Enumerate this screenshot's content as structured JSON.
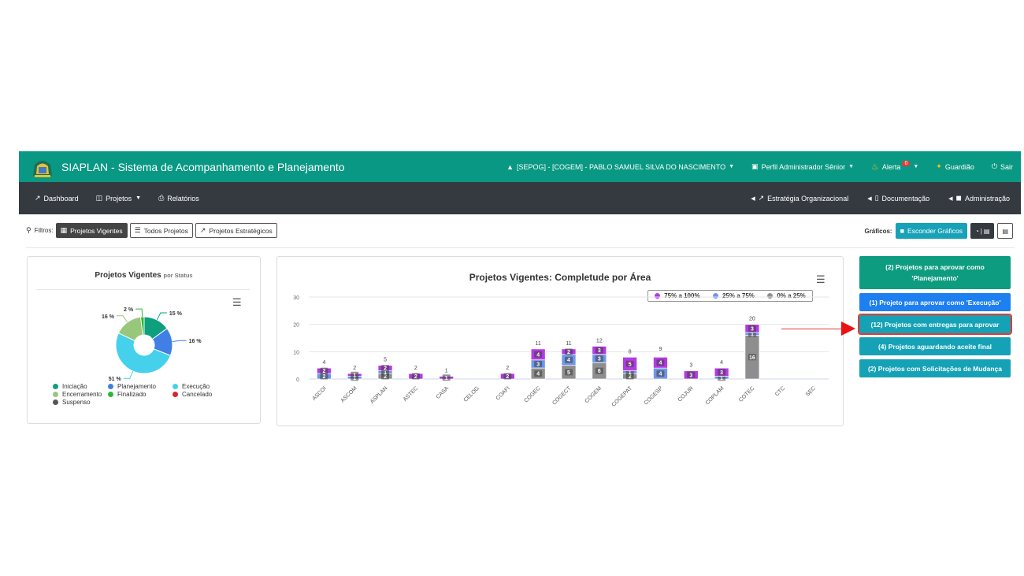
{
  "header": {
    "brand": "SIAPLAN - Sistema de Acompanhamento e Planejamento",
    "user": "[SEPOG] - [COGEM] - PABLO SAMUEL SILVA DO NASCIMENTO",
    "profile": "Perfil Administrador Sênior",
    "alert_label": "Alerta",
    "alert_count": "0",
    "guardian": "Guardião",
    "logout": "Sair"
  },
  "subnav": {
    "dashboard": "Dashboard",
    "projetos": "Projetos",
    "relatorios": "Relatórios",
    "estrategia": "Estratégia Organizacional",
    "documentacao": "Documentação",
    "administracao": "Administração"
  },
  "filters": {
    "label": "Filtros:",
    "vigentes": "Projetos Vigentes",
    "todos": "Todos Projetos",
    "estrategicos": "Projetos Estratégicos"
  },
  "graficos": {
    "label": "Gráficos:",
    "hide": "Esconder Gráficos",
    "pie_icon_sep": "|"
  },
  "pie_card": {
    "title": "Projetos Vigentes",
    "subtitle": "por Status"
  },
  "bar_card": {
    "title": "Projetos Vigentes: Completude por Área"
  },
  "chart_data": [
    {
      "type": "pie",
      "title": "Projetos Vigentes",
      "subtitle": "por Status",
      "slices": [
        {
          "label": "Iniciação",
          "value": 15,
          "display": "15 %",
          "color": "#0e9f7e"
        },
        {
          "label": "Planejamento",
          "value": 16,
          "display": "16 %",
          "color": "#3f7fe6"
        },
        {
          "label": "Execução",
          "value": 51,
          "display": "51 %",
          "color": "#45d0ec"
        },
        {
          "label": "Encerramento",
          "value": 16,
          "display": "16 %",
          "color": "#98c67b"
        },
        {
          "label": "Finalizado",
          "value": 2,
          "display": "2 %",
          "color": "#2ab935"
        },
        {
          "label": "Cancelado",
          "value": 0,
          "display": "",
          "color": "#d9252b"
        },
        {
          "label": "Suspenso",
          "value": 0,
          "display": "",
          "color": "#555555"
        }
      ]
    },
    {
      "type": "bar",
      "title": "Projetos Vigentes: Completude por Área",
      "categories": [
        "ASCOI",
        "ASCOM",
        "ASPLAN",
        "ASTEC",
        "CASA",
        "CELOG",
        "COAFI",
        "COGEC",
        "COGECT",
        "COGEM",
        "COGEPAT",
        "COGESP",
        "COJUR",
        "COPLAM",
        "COTEC",
        "CTC",
        "SEC"
      ],
      "series": [
        {
          "name": "0% a 25%",
          "color": "#8e8e8e",
          "values": [
            0,
            0,
            2,
            0,
            0,
            0,
            0,
            4,
            5,
            6,
            2,
            0,
            0,
            0,
            16,
            0,
            0
          ]
        },
        {
          "name": "25% a 75%",
          "color": "#6f96e8",
          "values": [
            2,
            1,
            1,
            0,
            0,
            0,
            0,
            3,
            4,
            3,
            1,
            4,
            0,
            1,
            1,
            0,
            0
          ]
        },
        {
          "name": "75% a 100%",
          "color": "#b33be3",
          "values": [
            2,
            1,
            2,
            2,
            1,
            0,
            2,
            4,
            2,
            3,
            5,
            4,
            3,
            3,
            3,
            0,
            0
          ]
        }
      ],
      "totals": [
        4,
        2,
        5,
        2,
        1,
        0,
        2,
        11,
        11,
        12,
        8,
        9,
        3,
        4,
        20,
        0,
        0
      ],
      "yticks": [
        0,
        10,
        20,
        30
      ],
      "ylim": [
        0,
        30
      ]
    }
  ],
  "actions": {
    "a1": "(2) Projetos para aprovar como 'Planejamento'",
    "a2": "(1) Projeto para aprovar como 'Execução'",
    "a3": "(12) Projetos com entregas para aprovar",
    "a4": "(4) Projetos aguardando aceite final",
    "a5": "(2) Projetos com Solicitações de Mudança"
  },
  "colors": {
    "topbar": "#099883",
    "subbar": "#343a40",
    "highlight": "#e53935"
  }
}
